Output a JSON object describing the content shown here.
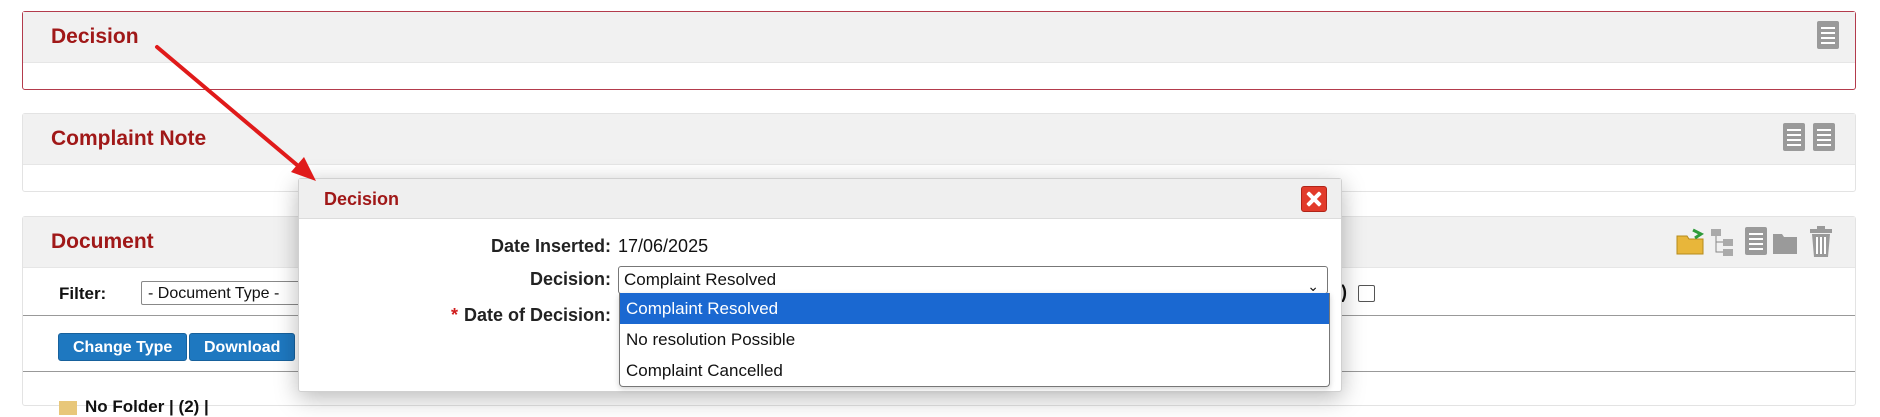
{
  "panels": {
    "decision": {
      "title": "Decision"
    },
    "complaint_note": {
      "title": "Complaint Note"
    },
    "document": {
      "title": "Document",
      "filter_label": "Filter:",
      "filter_value": "- Document Type -",
      "change_type_label": "Change Type",
      "download_label": "Download",
      "folder_row": "No Folder | (2) |",
      "partial_text": ")"
    }
  },
  "modal": {
    "title": "Decision",
    "date_inserted_label": "Date Inserted:",
    "date_inserted_value": "17/06/2025",
    "decision_label": "Decision:",
    "decision_value": "Complaint Resolved",
    "date_of_decision_label": "Date of Decision:",
    "required_mark": "*"
  },
  "dropdown": {
    "options": [
      "Complaint Resolved",
      "No resolution Possible",
      "Complaint Cancelled"
    ],
    "selected": "Complaint Resolved"
  },
  "icons": {
    "add_document": "add-document-icon",
    "notes": "notes-icon",
    "open_folder": "open-folder-icon",
    "tree": "tree-view-icon",
    "delete": "trash-icon",
    "close": "close-icon"
  },
  "colors": {
    "title_red": "#a01818",
    "button_blue": "#1e78c0",
    "selected_option": "#1a68d1",
    "arrow_red": "#e01a1a"
  }
}
